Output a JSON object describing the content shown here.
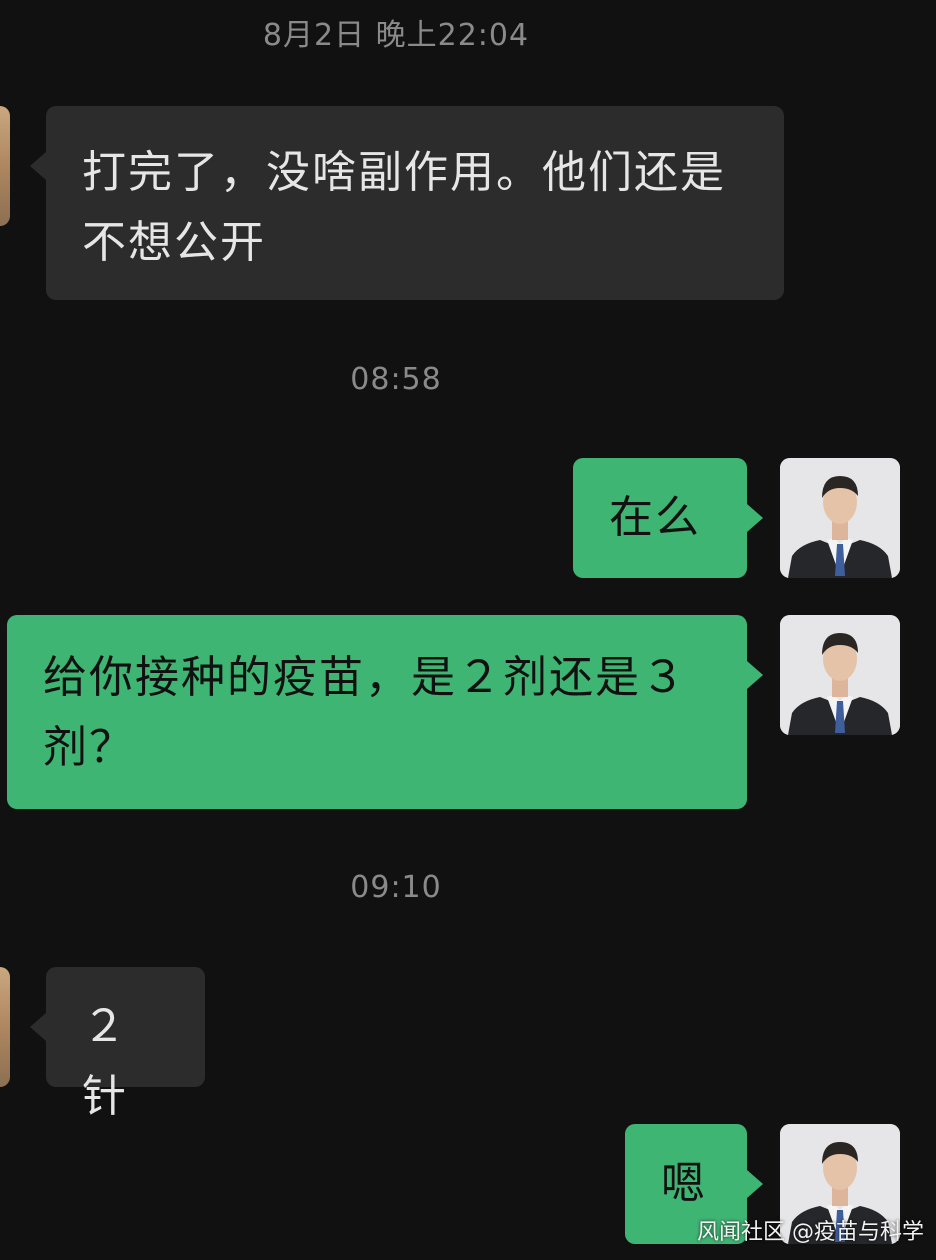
{
  "chat": {
    "timestamps": [
      "8月2日 晚上22:04",
      "08:58",
      "09:10"
    ],
    "messages": [
      {
        "direction": "incoming",
        "text": "打完了，没啥副作用。他们还是不想公开"
      },
      {
        "direction": "outgoing",
        "text": "在么"
      },
      {
        "direction": "outgoing",
        "text": "给你接种的疫苗，是２剂还是３剂？"
      },
      {
        "direction": "incoming",
        "text": "２针"
      },
      {
        "direction": "outgoing",
        "text": "嗯"
      }
    ]
  },
  "watermark": "风闻社区 @疫苗与科学",
  "colors": {
    "background": "#111111",
    "incoming_bubble": "#2c2c2c",
    "outgoing_bubble": "#3fb574",
    "timestamp_text": "#8a8a8a"
  }
}
